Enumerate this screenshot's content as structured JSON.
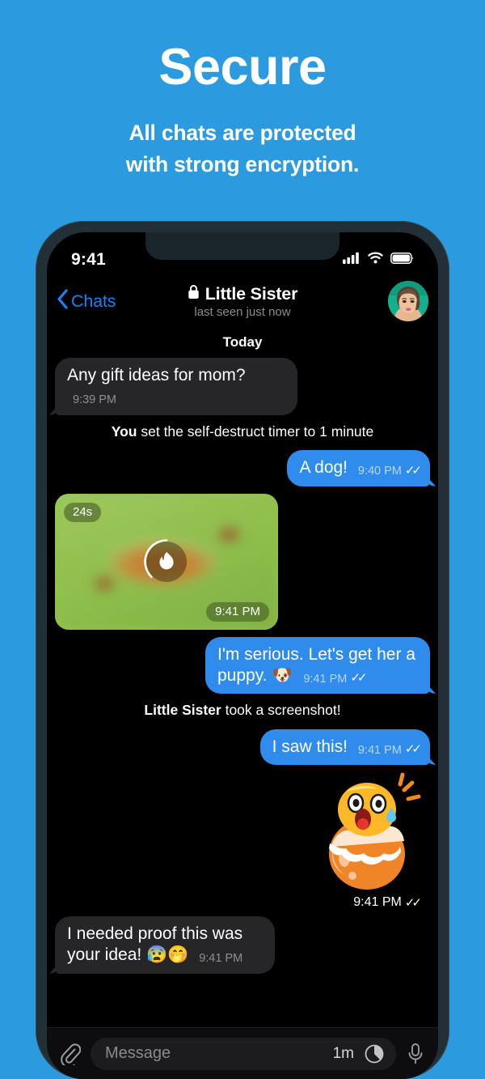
{
  "promo": {
    "title": "Secure",
    "subtitle_line1": "All chats are protected",
    "subtitle_line2": "with strong encryption."
  },
  "colors": {
    "background_blue": "#2b9ade",
    "outgoing_bubble": "#2f8ced",
    "incoming_bubble": "#262628",
    "accent_link": "#1c81f2",
    "photo_green": "#93c24f"
  },
  "status_bar": {
    "time": "9:41",
    "icons": [
      "cellular-signal-icon",
      "wifi-icon",
      "battery-icon"
    ]
  },
  "chat_header": {
    "back_label": "Chats",
    "back_icon": "chevron-left-icon",
    "lock_icon": "lock-icon",
    "title": "Little Sister",
    "subtitle": "last seen just now",
    "avatar_name": "avatar"
  },
  "conversation": {
    "day_divider": "Today",
    "messages": [
      {
        "kind": "text",
        "direction": "in",
        "text": "Any gift ideas for mom?",
        "time": "9:39 PM",
        "ticks": ""
      },
      {
        "kind": "service",
        "bold": "You",
        "rest": " set the self-destruct timer to 1 minute"
      },
      {
        "kind": "text",
        "direction": "out",
        "text": "A dog!",
        "time": "9:40 PM",
        "ticks": "✓✓"
      },
      {
        "kind": "photo",
        "direction": "in",
        "timer_badge": "24s",
        "time": "9:41 PM",
        "overlay_icon": "flame-icon",
        "alt": "blurred photo of a hot dog on grass"
      },
      {
        "kind": "text",
        "direction": "out",
        "text": "I'm serious. Let's get her a puppy. 🐶",
        "time": "9:41 PM",
        "ticks": "✓✓"
      },
      {
        "kind": "service",
        "bold": "Little Sister",
        "rest": " took a screenshot!"
      },
      {
        "kind": "text",
        "direction": "out",
        "text": "I saw this!",
        "time": "9:41 PM",
        "ticks": "✓✓"
      },
      {
        "kind": "sticker",
        "direction": "out",
        "sticker_name": "shocked-egg-sticker",
        "time": "9:41 PM",
        "ticks": "✓✓"
      },
      {
        "kind": "text",
        "direction": "in",
        "text": "I needed proof this was your idea! 😰🤭",
        "time": "9:41 PM",
        "ticks": ""
      }
    ]
  },
  "input_bar": {
    "attach_icon": "paperclip-icon",
    "placeholder": "Message",
    "self_destruct_timer": "1m",
    "timer_icon": "self-destruct-timer-icon",
    "voice_icon": "microphone-icon"
  }
}
